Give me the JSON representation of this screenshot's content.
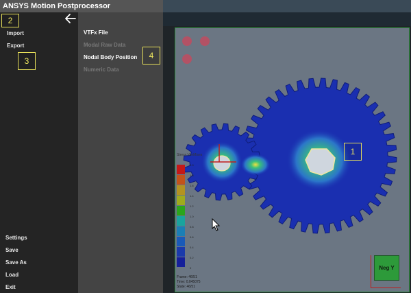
{
  "app": {
    "title": "ANSYS Motion Postprocessor"
  },
  "left_menu": {
    "import": "Import",
    "export": "Export",
    "settings": "Settings",
    "save": "Save",
    "save_as": "Save As",
    "load": "Load",
    "exit": "Exit"
  },
  "sub_menu": {
    "items": [
      {
        "label": "VTFx File",
        "enabled": true
      },
      {
        "label": "Modal Raw Data",
        "enabled": false
      },
      {
        "label": "Nodal Body Position",
        "enabled": true
      },
      {
        "label": "Numeric Data",
        "enabled": false
      }
    ]
  },
  "callouts": [
    "1",
    "2",
    "3",
    "4"
  ],
  "viewport": {
    "legend_title": "Stress VonMises",
    "legend_colors": [
      "#c41818",
      "#c3531b",
      "#b39321",
      "#9fab1d",
      "#2ba61c",
      "#1aa49e",
      "#1b7fb5",
      "#1a5ab8",
      "#1a3aab",
      "#15209a"
    ],
    "legend_labels": [
      "2.0",
      "1.8",
      "1.6",
      "1.4",
      "1.2",
      "1.0",
      "0.8",
      "0.6",
      "0.4",
      "0.2",
      "0"
    ],
    "frame": "Frame: 46/51",
    "time": "Time: 0.045075",
    "state": "State: 46/51",
    "view_cube_label": "Neg Y",
    "icons": [
      "eye-off-icon",
      "link-icon",
      "document-icon"
    ]
  }
}
